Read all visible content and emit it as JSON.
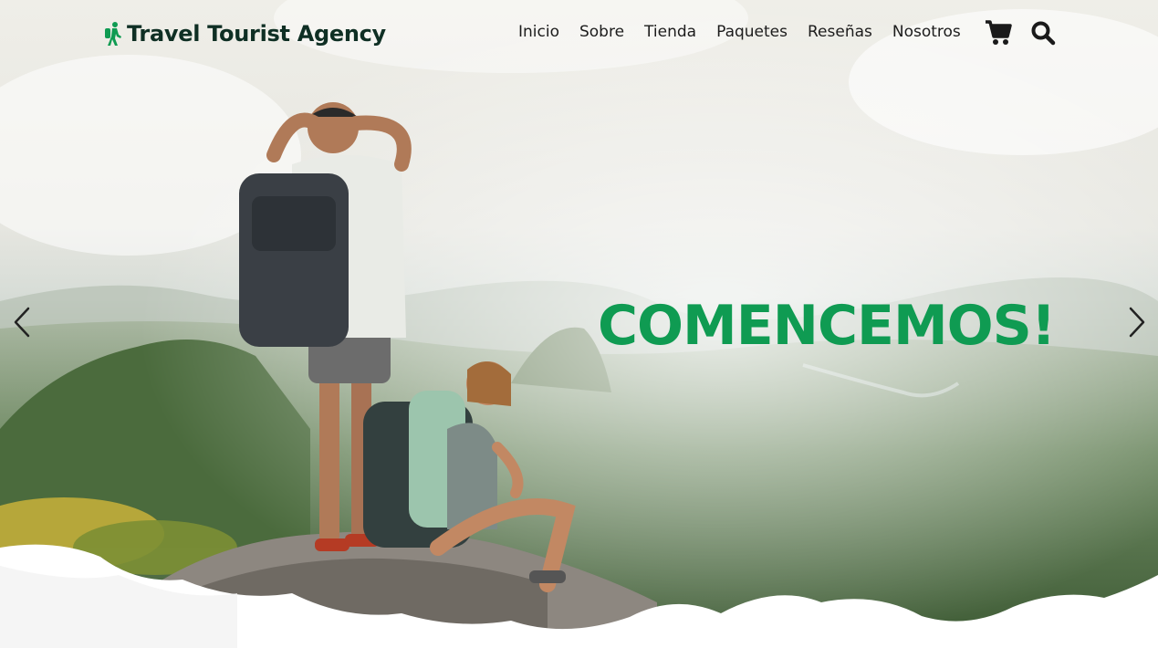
{
  "brand": {
    "name": "Travel Tourist Agency",
    "accent": "#0f9b52",
    "logo_icon": "hiker-icon"
  },
  "nav": {
    "items": [
      "Inicio",
      "Sobre",
      "Tienda",
      "Paquetes",
      "Reseñas",
      "Nosotros"
    ],
    "cart_icon": "shopping-cart-icon",
    "search_icon": "search-icon"
  },
  "hero": {
    "headline": "COMENCEMOS!",
    "prev_icon": "chevron-left-icon",
    "next_icon": "chevron-right-icon"
  }
}
